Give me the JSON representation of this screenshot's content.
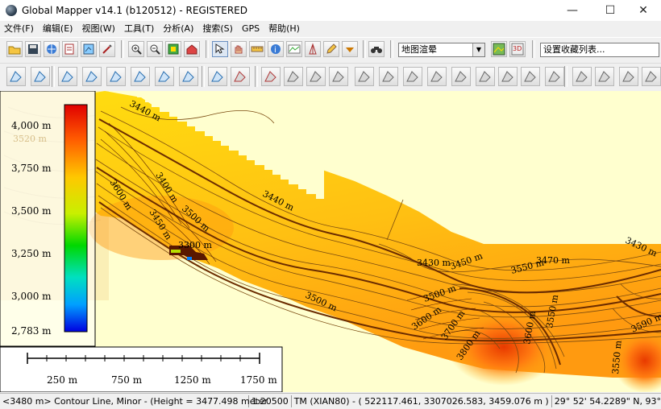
{
  "window": {
    "title": "Global Mapper v14.1 (b120512) - REGISTERED",
    "minimize": "—",
    "maximize": "☐",
    "close": "✕"
  },
  "menu": [
    {
      "label": "文件(F)"
    },
    {
      "label": "编辑(E)"
    },
    {
      "label": "视图(W)"
    },
    {
      "label": "工具(T)"
    },
    {
      "label": "分析(A)"
    },
    {
      "label": "搜索(S)"
    },
    {
      "label": "GPS"
    },
    {
      "label": "帮助(H)"
    }
  ],
  "toolbar": {
    "shader_select": "地图渲晕",
    "bookmark_select": "设置收藏列表..."
  },
  "legend": {
    "labels": [
      "4,000 m",
      "3,750 m",
      "3,500 m",
      "3,250 m",
      "3,000 m",
      "2,783 m"
    ],
    "ghost_label": "3520 m"
  },
  "scale_bar": {
    "labels": [
      "250 m",
      "750 m",
      "1250 m",
      "1750 m"
    ]
  },
  "map": {
    "contour_labels": [
      {
        "text": "3440 m"
      },
      {
        "text": "3440 m"
      },
      {
        "text": "3400 m"
      },
      {
        "text": "3500 m"
      },
      {
        "text": "3600 m"
      },
      {
        "text": "3450 m"
      },
      {
        "text": "3300 m"
      },
      {
        "text": "3430 m"
      },
      {
        "text": "3430 m"
      },
      {
        "text": "3450 m"
      },
      {
        "text": "3470 m"
      },
      {
        "text": "3500 m"
      },
      {
        "text": "3500 m"
      },
      {
        "text": "3550 m"
      },
      {
        "text": "3600 m"
      },
      {
        "text": "3700 m"
      },
      {
        "text": "3800 m"
      },
      {
        "text": "3600 m"
      },
      {
        "text": "3550 m"
      },
      {
        "text": "3550 m"
      },
      {
        "text": "3590 m"
      }
    ]
  },
  "status": {
    "feature": "<3480 m> Contour Line, Minor - (Height = 3477.498 meter",
    "scale": "1:20500",
    "projection": "TM (XIAN80) - ( 522117.461, 3307026.583, 3459.076 m )",
    "latlon": "29° 52' 54.2289\" N, 93° 13' 4"
  },
  "colors": {
    "map_background": "#ffffcf",
    "terrain_yellow": "#ffe21a",
    "terrain_orange": "#ff9a10",
    "terrain_red": "#f04a00",
    "contour_major": "#6b2c00",
    "contour_minor": "#7a4a10"
  }
}
